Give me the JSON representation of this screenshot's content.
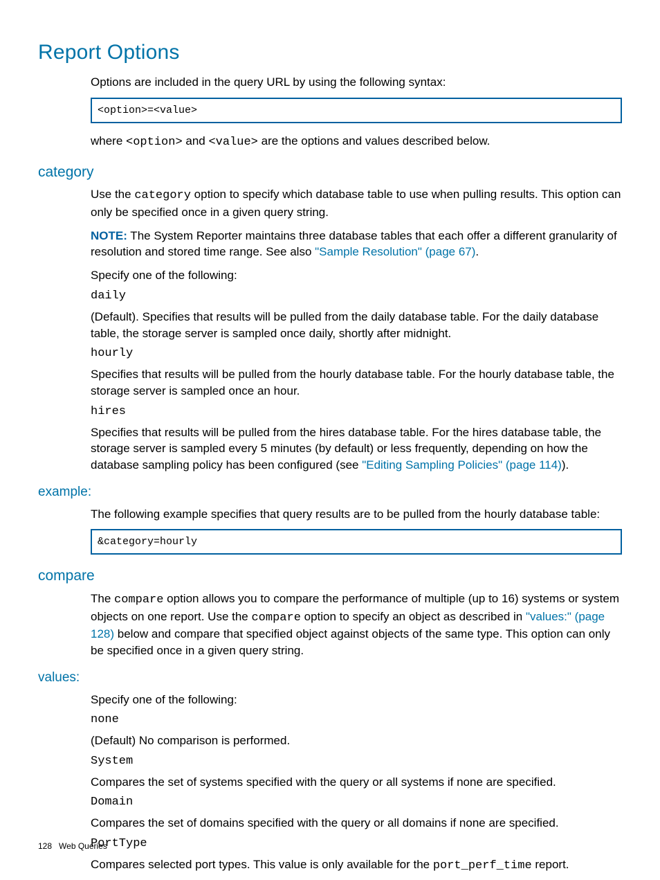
{
  "h1": "Report Options",
  "intro": "Options are included in the query URL by using the following syntax:",
  "codebox1": "<option>=<value>",
  "intro2_pre": "where ",
  "intro2_code1": "<option>",
  "intro2_mid": " and ",
  "intro2_code2": "<value>",
  "intro2_post": " are the options and values described below.",
  "category_h": "category",
  "category_p1_pre": "Use the ",
  "category_p1_code": "category",
  "category_p1_post": " option to specify which database table to use when pulling results. This option can only be specified once in a given query string.",
  "note_label": "NOTE:",
  "note_text": " The System Reporter maintains three database tables that each offer a different granularity of resolution and stored time range. See also ",
  "note_link": "\"Sample Resolution\" (page 67)",
  "note_post": ".",
  "specify_line": "Specify one of the following:",
  "cat_daily_code": "daily",
  "cat_daily_desc": "(Default). Specifies that results will be pulled from the daily database table. For the daily database table, the storage server is sampled once daily, shortly after midnight.",
  "cat_hourly_code": "hourly",
  "cat_hourly_desc": "Specifies that results will be pulled from the hourly database table. For the hourly database table, the storage server is sampled once an hour.",
  "cat_hires_code": "hires",
  "cat_hires_desc_pre": "Specifies that results will be pulled from the hires database table. For the hires database table, the storage server is sampled every 5 minutes (by default) or less frequently, depending on how the database sampling policy has been configured (see ",
  "cat_hires_link": "\"Editing Sampling Policies\" (page 114)",
  "cat_hires_desc_post": ").",
  "example_h": "example:",
  "example_p": "The following example specifies that query results are to be pulled from the hourly database table:",
  "codebox2": "&category=hourly",
  "compare_h": "compare",
  "compare_p_pre": "The ",
  "compare_p_code1": "compare",
  "compare_p_mid1": " option allows you to compare the performance of multiple (up to 16) systems or system objects on one report. Use the ",
  "compare_p_code2": "compare",
  "compare_p_mid2": " option to specify an object as described in ",
  "compare_link": "\"values:\" (page 128)",
  "compare_p_post": " below and compare that specified object against objects of the same type. This option can only be specified once in a given query string.",
  "values_h": "values:",
  "values_specify": "Specify one of the following:",
  "val_none_code": "none",
  "val_none_desc": "(Default) No comparison is performed.",
  "val_system_code": "System",
  "val_system_desc": "Compares the set of systems specified with the query or all systems if none are specified.",
  "val_domain_code": "Domain",
  "val_domain_desc": "Compares the set of domains specified with the query or all domains if none are specified.",
  "val_port_code": "PortType",
  "val_port_desc_pre": "Compares selected port types. This value is only available for the ",
  "val_port_desc_code": "port_perf_time",
  "val_port_desc_post": " report.",
  "footer_page": "128",
  "footer_title": "Web Queries"
}
